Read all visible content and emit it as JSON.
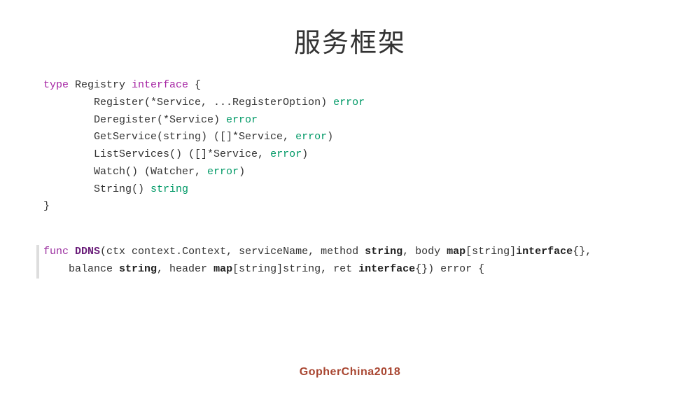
{
  "title": "服务框架",
  "footer": "GopherChina2018",
  "code1": {
    "kw_type": "type",
    "registry": " Registry ",
    "kw_interface": "interface",
    "brace_open": " {",
    "line_register_pre": "        Register(*Service, ...RegisterOption) ",
    "kw_error1": "error",
    "line_deregister_pre": "        Deregister(*Service) ",
    "kw_error2": "error",
    "line_getservice_pre": "        GetService(string) ([]*Service, ",
    "kw_error3": "error",
    "line_getservice_post": ")",
    "line_listservices_pre": "        ListServices() ([]*Service, ",
    "kw_error4": "error",
    "line_listservices_post": ")",
    "line_watch_pre": "        Watch() (Watcher, ",
    "kw_error5": "error",
    "line_watch_post": ")",
    "line_string_pre": "        String() ",
    "kw_string": "string",
    "brace_close": "}"
  },
  "code2": {
    "kw_func": "func",
    "sp1": " ",
    "fn_name": "DDNS",
    "sig1": "(ctx context.Context, serviceName, method ",
    "kw_string1": "string",
    "sig2": ", body ",
    "kw_map1": "map",
    "sig3": "[string]",
    "kw_interface1": "interface",
    "sig4": "{},",
    "line2_pre": "    balance ",
    "kw_string2": "string",
    "line2_mid1": ", header ",
    "kw_map2": "map",
    "line2_mid2": "[string]string, ret ",
    "kw_interface2": "interface",
    "line2_post": "{}) error {"
  }
}
